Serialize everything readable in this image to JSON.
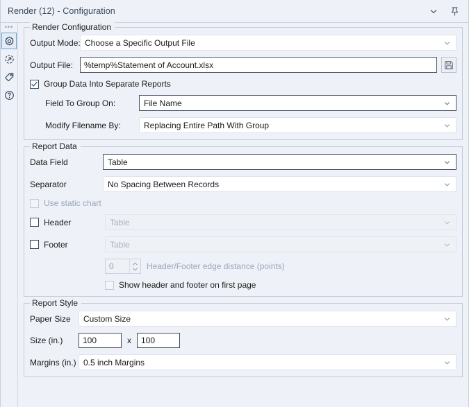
{
  "window": {
    "title": "Render (12) - Configuration",
    "collapse_icon": "chevron-down-icon",
    "pin_icon": "pin-icon"
  },
  "sidebar": {
    "items": [
      {
        "icon": "gear-icon",
        "name": "configuration",
        "selected": true
      },
      {
        "icon": "arrow-circle-icon",
        "name": "output",
        "selected": false
      },
      {
        "icon": "tag-icon",
        "name": "annotation",
        "selected": false
      },
      {
        "icon": "question-circle-icon",
        "name": "help",
        "selected": false
      }
    ]
  },
  "render_configuration": {
    "legend": "Render Configuration",
    "output_mode": {
      "label": "Output Mode:",
      "value": "Choose a Specific Output File"
    },
    "output_file": {
      "label": "Output File:",
      "value": "%temp%Statement of Account.xlsx",
      "browse_icon": "save-icon"
    },
    "group_data": {
      "label": "Group Data Into Separate Reports",
      "checked": true
    },
    "field_to_group_on": {
      "label": "Field To Group On:",
      "value": "File Name"
    },
    "modify_filename_by": {
      "label": "Modify Filename By:",
      "value": "Replacing Entire Path With Group"
    }
  },
  "report_data": {
    "legend": "Report Data",
    "data_field": {
      "label": "Data Field",
      "value": "Table"
    },
    "separator": {
      "label": "Separator",
      "value": "No Spacing Between Records"
    },
    "use_static_chart": {
      "label": "Use static chart",
      "checked": false,
      "enabled": false
    },
    "header": {
      "label": "Header",
      "checked": false,
      "value": "Table"
    },
    "footer": {
      "label": "Footer",
      "checked": false,
      "value": "Table"
    },
    "edge_distance": {
      "value": "0",
      "label": "Header/Footer edge distance (points)"
    },
    "show_on_first_page": {
      "label": "Show header and footer on first page",
      "checked": false
    }
  },
  "report_style": {
    "legend": "Report Style",
    "paper_size": {
      "label": "Paper Size",
      "value": "Custom Size"
    },
    "size": {
      "label": "Size (in.)",
      "width": "100",
      "separator": "x",
      "height": "100"
    },
    "margins": {
      "label": "Margins (in.)",
      "value": "0.5 inch Margins"
    }
  },
  "colors": {
    "panel_bg": "#eef1f7",
    "field_bg": "#ffffff",
    "accent": "#6d9ec9",
    "border": "#c3ccda",
    "disabled_text": "#9aa7bb"
  }
}
